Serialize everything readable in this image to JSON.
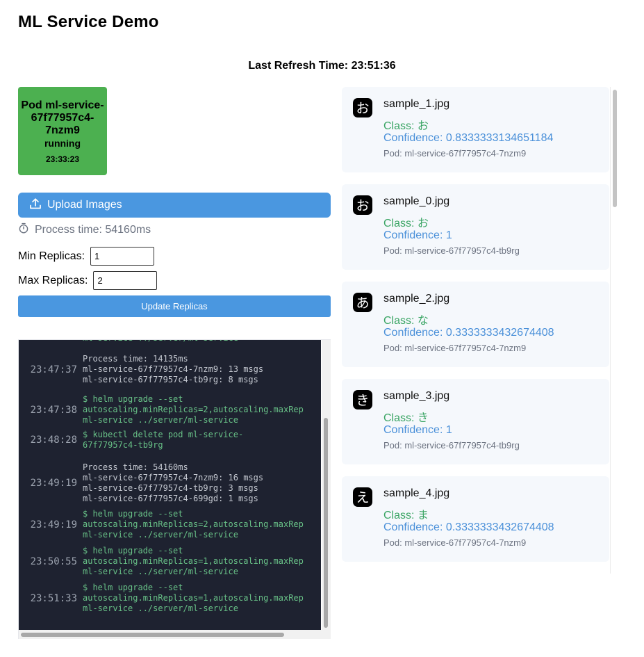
{
  "app": {
    "title": "ML Service Demo"
  },
  "refresh": {
    "text": "Last Refresh Time: 23:51:36"
  },
  "pod": {
    "name": "Pod ml-service-67f77957c4-7nzm9",
    "status": "running",
    "time": "23:33:23",
    "color": "#4cb050"
  },
  "controls": {
    "upload_label": "Upload Images",
    "process_time": "Process time: 54160ms",
    "min_label": "Min Replicas:",
    "min_value": "1",
    "max_label": "Max Replicas:",
    "max_value": "2",
    "update_label": "Update Replicas",
    "accent": "#4a97e0"
  },
  "logs": [
    {
      "time": "",
      "kind": "cmd",
      "lines": [
        "ml-service ../server/ml-service"
      ]
    },
    {
      "time": "23:47:37",
      "kind": "out",
      "lines": [
        "Process time: 14135ms",
        "ml-service-67f77957c4-7nzm9: 13 msgs",
        "ml-service-67f77957c4-tb9rg: 8 msgs"
      ]
    },
    {
      "time": "23:47:38",
      "kind": "cmd",
      "lines": [
        "$ helm upgrade --set",
        "autoscaling.minReplicas=2,autoscaling.maxRep",
        "ml-service ../server/ml-service"
      ]
    },
    {
      "time": "23:48:28",
      "kind": "cmd",
      "lines": [
        "$ kubectl delete pod ml-service-",
        "67f77957c4-tb9rg"
      ]
    },
    {
      "time": "23:49:19",
      "kind": "out",
      "lines": [
        "Process time: 54160ms",
        "ml-service-67f77957c4-7nzm9: 16 msgs",
        "ml-service-67f77957c4-tb9rg: 3 msgs",
        "ml-service-67f77957c4-699gd: 1 msgs"
      ]
    },
    {
      "time": "23:49:19",
      "kind": "cmd",
      "lines": [
        "$ helm upgrade --set",
        "autoscaling.minReplicas=2,autoscaling.maxRep",
        "ml-service ../server/ml-service"
      ]
    },
    {
      "time": "23:50:55",
      "kind": "cmd",
      "lines": [
        "$ helm upgrade --set",
        "autoscaling.minReplicas=1,autoscaling.maxRep",
        "ml-service ../server/ml-service"
      ]
    },
    {
      "time": "23:51:33",
      "kind": "cmd",
      "lines": [
        "$ helm upgrade --set",
        "autoscaling.minReplicas=1,autoscaling.maxRep",
        "ml-service ../server/ml-service"
      ]
    }
  ],
  "results": [
    {
      "file": "sample_1.jpg",
      "class": "Class: お",
      "confidence": "Confidence: 0.8333333134651184",
      "pod": "Pod: ml-service-67f77957c4-7nzm9",
      "glyph": "お"
    },
    {
      "file": "sample_0.jpg",
      "class": "Class: お",
      "confidence": "Confidence: 1",
      "pod": "Pod: ml-service-67f77957c4-tb9rg",
      "glyph": "お"
    },
    {
      "file": "sample_2.jpg",
      "class": "Class: な",
      "confidence": "Confidence: 0.3333333432674408",
      "pod": "Pod: ml-service-67f77957c4-7nzm9",
      "glyph": "あ"
    },
    {
      "file": "sample_3.jpg",
      "class": "Class: き",
      "confidence": "Confidence: 1",
      "pod": "Pod: ml-service-67f77957c4-tb9rg",
      "glyph": "き"
    },
    {
      "file": "sample_4.jpg",
      "class": "Class: ま",
      "confidence": "Confidence: 0.3333333432674408",
      "pod": "Pod: ml-service-67f77957c4-7nzm9",
      "glyph": "え"
    }
  ]
}
